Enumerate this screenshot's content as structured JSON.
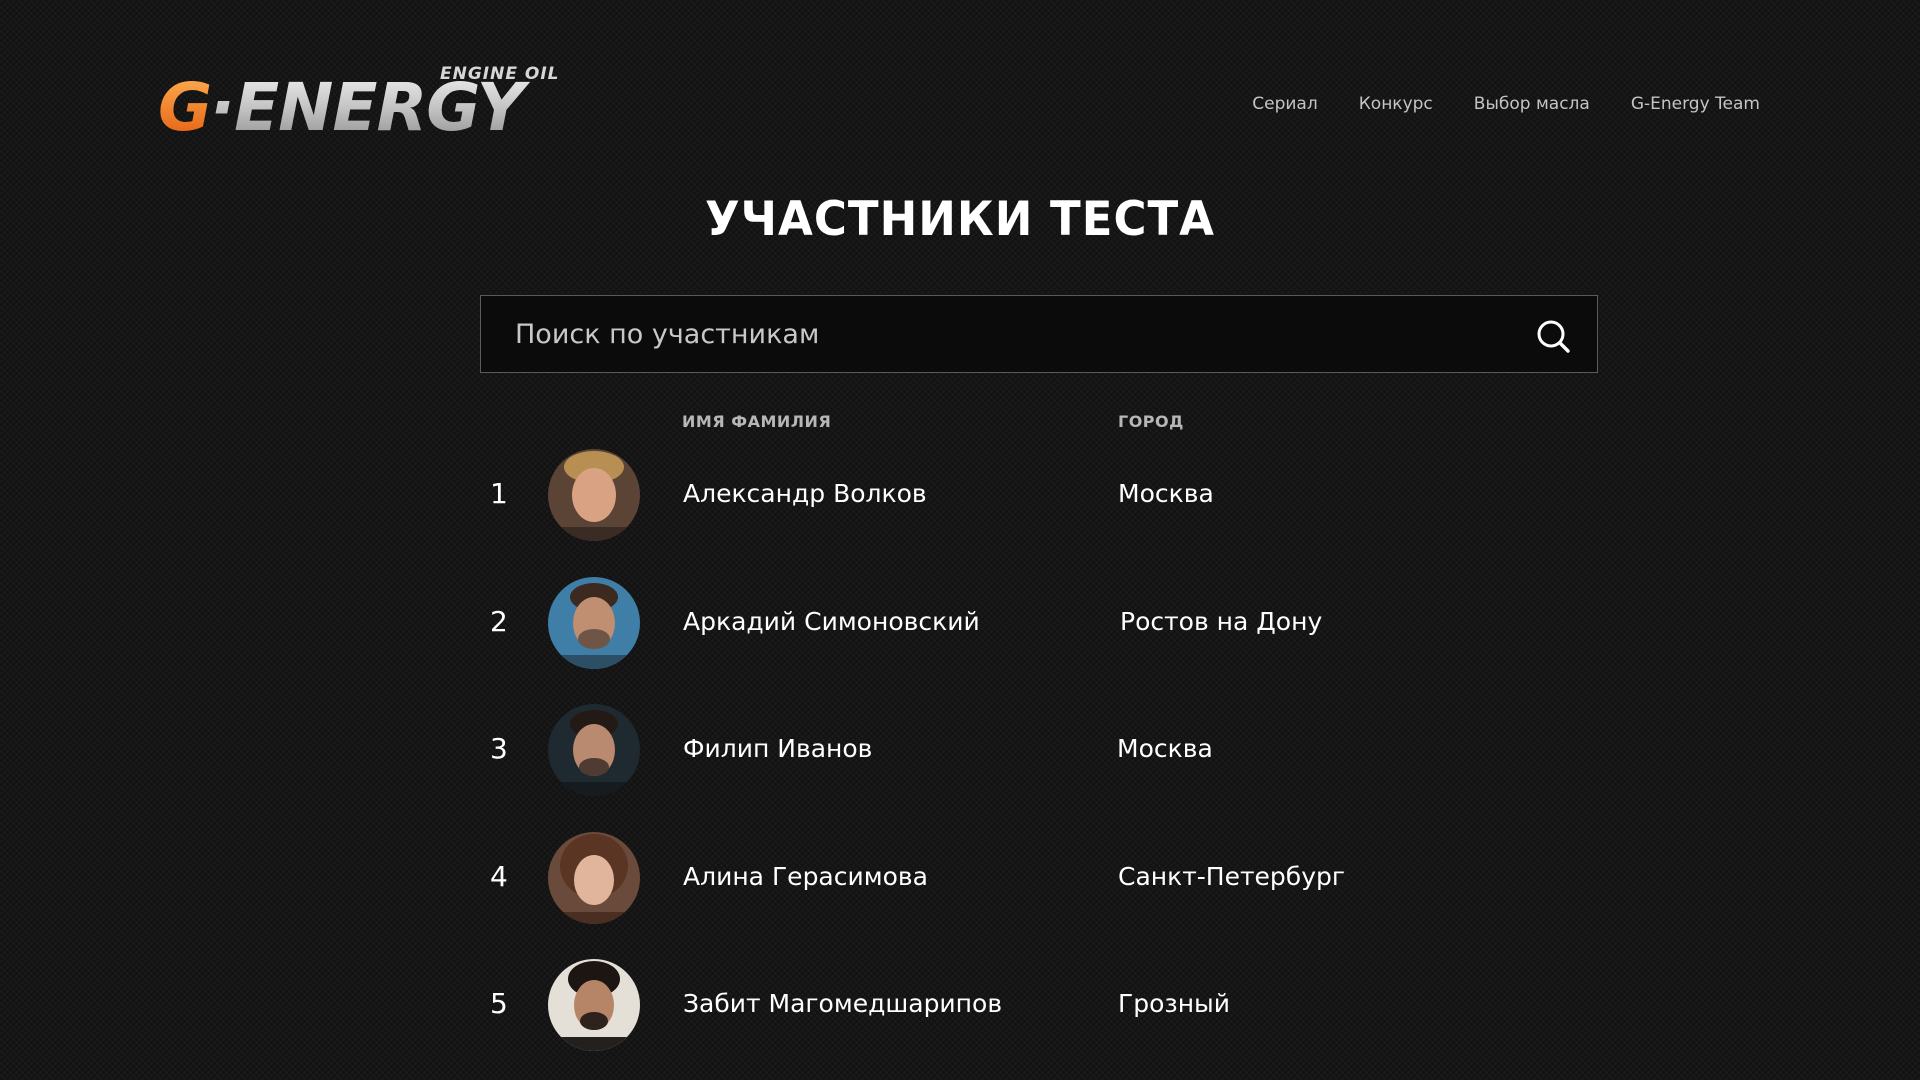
{
  "header": {
    "logo": {
      "brand": "G-ENERGY",
      "tagline": "ENGINE OIL",
      "icon": "g-energy-logo"
    },
    "nav": [
      {
        "label": "Сериал"
      },
      {
        "label": "Конкурс"
      },
      {
        "label": "Выбор масла"
      },
      {
        "label": "G-Energy Team"
      }
    ]
  },
  "page": {
    "title": "УЧАСТНИКИ ТЕСТА"
  },
  "search": {
    "placeholder": "Поиск по участникам",
    "value": "",
    "icon": "search-icon"
  },
  "table": {
    "headers": {
      "name": "ИМЯ ФАМИЛИЯ",
      "city": "ГОРОД"
    },
    "rows": [
      {
        "rank": "1",
        "name": "Александр Волков",
        "city": "Москва",
        "avatar": "avatar-photo"
      },
      {
        "rank": "2",
        "name": "Аркадий Симоновский",
        "city": "Ростов на Дону",
        "avatar": "avatar-photo"
      },
      {
        "rank": "3",
        "name": "Филип Иванов",
        "city": "Москва",
        "avatar": "avatar-photo"
      },
      {
        "rank": "4",
        "name": "Алина Герасимова",
        "city": "Санкт-Петербург",
        "avatar": "avatar-photo"
      },
      {
        "rank": "5",
        "name": "Забит Магомедшарипов",
        "city": "Грозный",
        "avatar": "avatar-photo"
      }
    ]
  },
  "colors": {
    "background": "#131313",
    "logo_orange": "#f5821f",
    "logo_silver": "#c9c9c9",
    "text": "#ffffff",
    "muted_text": "#c4c4c4",
    "search_border": "#5a5a5a"
  }
}
